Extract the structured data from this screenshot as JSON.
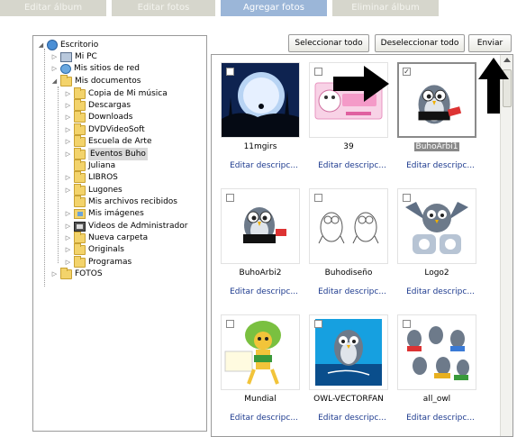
{
  "tabs": {
    "edit_album": "Editar álbum",
    "edit_photos": "Editar fotos",
    "add_photos": "Agregar fotos",
    "delete_album": "Eliminar álbum"
  },
  "buttons": {
    "select_all": "Seleccionar todo",
    "deselect_all": "Deseleccionar todo",
    "send": "Enviar"
  },
  "tree": {
    "root": "Escritorio",
    "my_pc": "Mi PC",
    "network": "Mis sitios de red",
    "documents": "Mis documentos",
    "doc_items": [
      "Copia de Mi música",
      "Descargas",
      "Downloads",
      "DVDVideoSoft",
      "Escuela de Arte",
      "Eventos Buho",
      "Juliana",
      "LIBROS",
      "Lugones",
      "Mis archivos recibidos",
      "Mis imágenes",
      "Videos de Administrador",
      "Nueva carpeta",
      "Originals",
      "Programas"
    ],
    "fotos": "FOTOS"
  },
  "photos": [
    {
      "name": "11mgirs",
      "edit": "Editar descripc...",
      "checked": false,
      "selected": false
    },
    {
      "name": "39",
      "edit": "Editar descripc...",
      "checked": false,
      "selected": false
    },
    {
      "name": "BuhoArbi1",
      "edit": "Editar descripc...",
      "checked": true,
      "selected": true
    },
    {
      "name": "BuhoArbi2",
      "edit": "Editar descripc...",
      "checked": false,
      "selected": false
    },
    {
      "name": "Buhodiseño",
      "edit": "Editar descripc...",
      "checked": false,
      "selected": false
    },
    {
      "name": "Logo2",
      "edit": "Editar descripc...",
      "checked": false,
      "selected": false
    },
    {
      "name": "Mundial",
      "edit": "Editar descripc...",
      "checked": false,
      "selected": false
    },
    {
      "name": "OWL-VECTORFAN",
      "edit": "Editar descripc...",
      "checked": false,
      "selected": false
    },
    {
      "name": "all_owl",
      "edit": "Editar descripc...",
      "checked": false,
      "selected": false
    }
  ],
  "colors": {
    "active_tab": "#9bb6d8",
    "inactive_tab": "#d6d6cc",
    "link": "#1e3b8f"
  }
}
